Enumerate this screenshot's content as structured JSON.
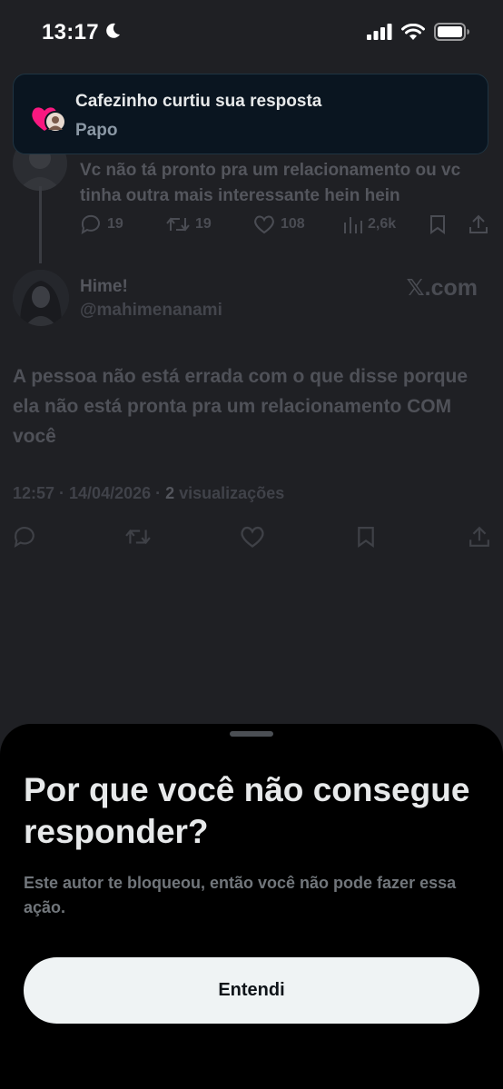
{
  "status_bar": {
    "time": "13:17"
  },
  "notification": {
    "title": "Cafezinho curtiu sua resposta",
    "subtitle": "Papo"
  },
  "previous_post": {
    "text": "Vc não tá pronto pra um relacionamento ou vc tinha outra mais interessante hein hein",
    "replies": "19",
    "reposts": "19",
    "likes": "108",
    "views": "2,6k"
  },
  "post": {
    "author_name": "Hime!",
    "author_handle": "@mahimenanami",
    "watermark": "𝕏.com",
    "text": "A pessoa não está errada com o que disse porque ela não está pronta pra um relacionamento COM você",
    "meta_prefix": "12:57 · 14/04/2026 · ",
    "views_count": "2",
    "views_label": " visualizações"
  },
  "sheet": {
    "title": "Por que você não consegue responder?",
    "description": "Este autor te bloqueou, então você não pode fazer essa ação.",
    "button_label": "Entendi"
  },
  "colors": {
    "background": "#1f2024",
    "sheet": "#000000",
    "button": "#eff3f4",
    "toast": "#0a1520",
    "heart": "#f91880"
  }
}
